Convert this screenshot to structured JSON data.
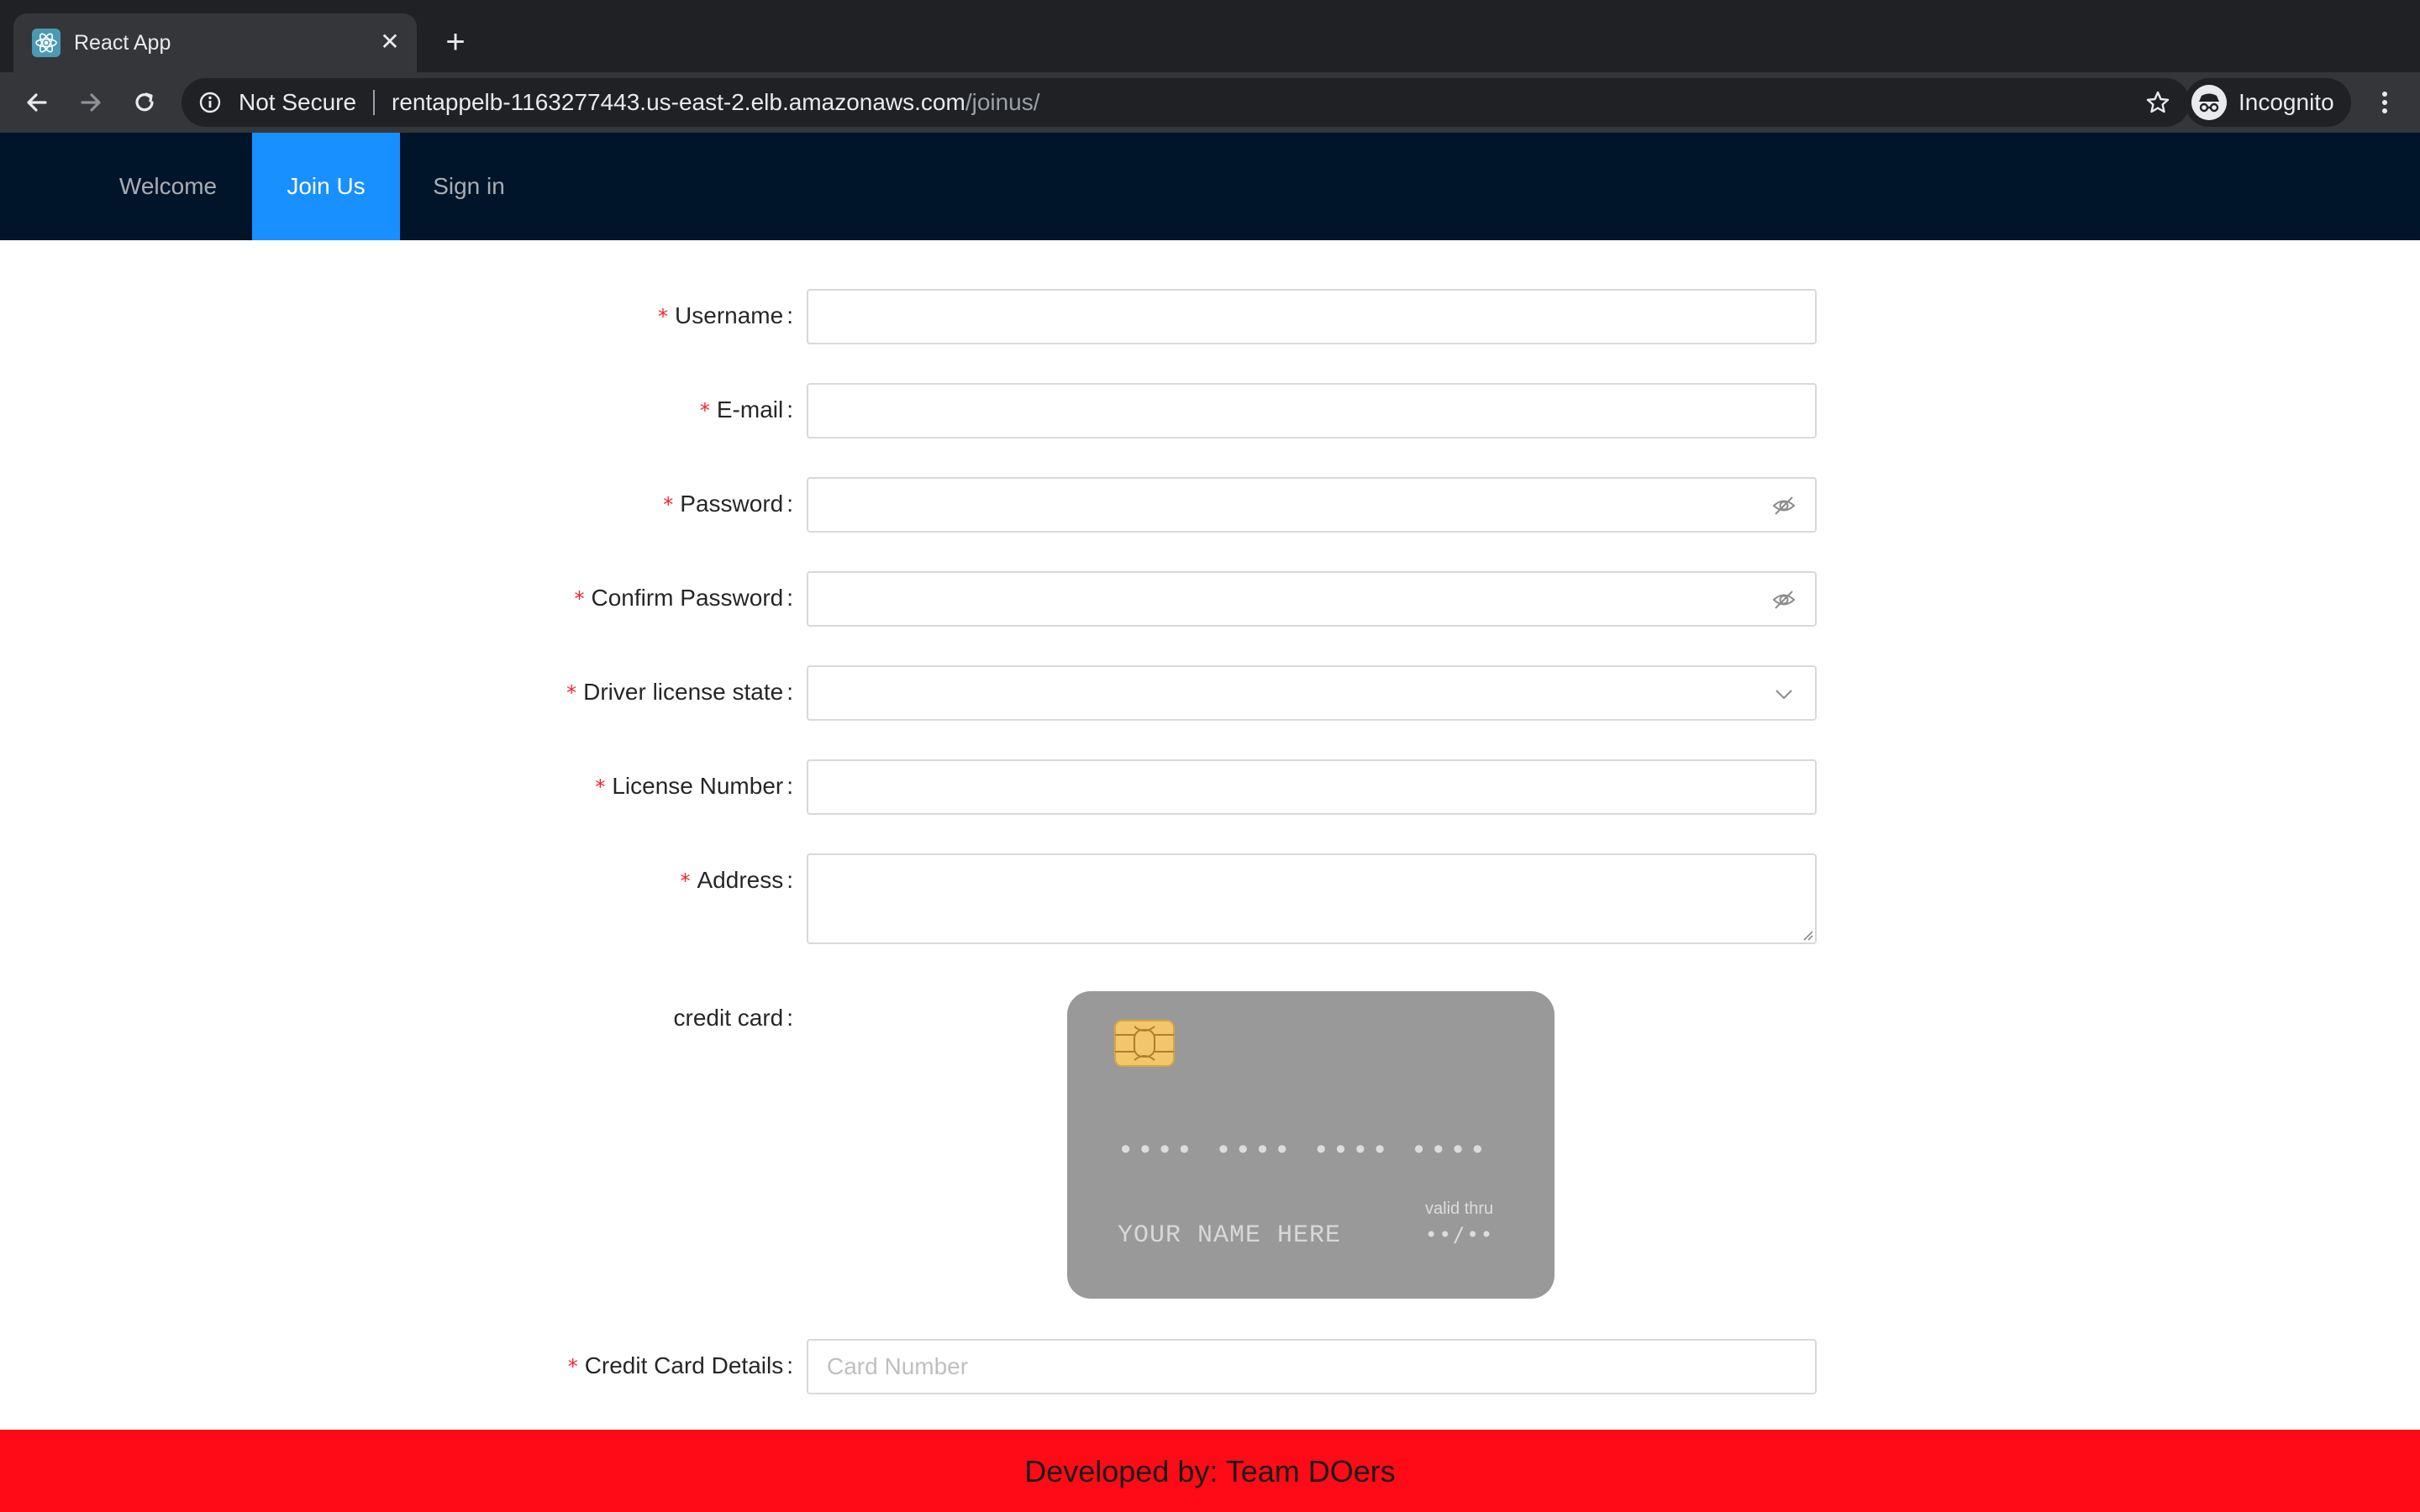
{
  "browser": {
    "tab_title": "React App",
    "tab_close": "✕",
    "new_tab": "+",
    "security_label": "Not Secure",
    "url_host": "rentappelb-1163277443.us-east-2.elb.amazonaws.com",
    "url_path": "/joinus/",
    "profile_label": "Incognito",
    "icons": [
      "back-icon",
      "forward-icon",
      "reload-icon",
      "info-icon",
      "star-icon",
      "incognito-icon",
      "menu-icon"
    ]
  },
  "nav": {
    "items": [
      {
        "label": "Welcome",
        "active": false
      },
      {
        "label": "Join Us",
        "active": true
      },
      {
        "label": "Sign in",
        "active": false
      }
    ],
    "background": "#001529",
    "active_color": "#1890ff"
  },
  "form": {
    "required_mark": "*",
    "colon": ":",
    "username_label": "Username",
    "email_label": "E-mail",
    "password_label": "Password",
    "confirm_password_label": "Confirm Password",
    "license_state_label": "Driver license state",
    "license_number_label": "License Number",
    "address_label": "Address",
    "credit_card_label": "credit card",
    "credit_card_details_label": "Credit Card Details",
    "card_number_placeholder": "Card Number"
  },
  "card": {
    "number_mask": "•••• •••• •••• ••••",
    "name_placeholder": "YOUR NAME HERE",
    "valid_label": "valid thru",
    "valid_value": "••/••",
    "color": "#999999"
  },
  "footer": {
    "text": "Developed by: Team DOers",
    "color": "#ff0a16"
  }
}
